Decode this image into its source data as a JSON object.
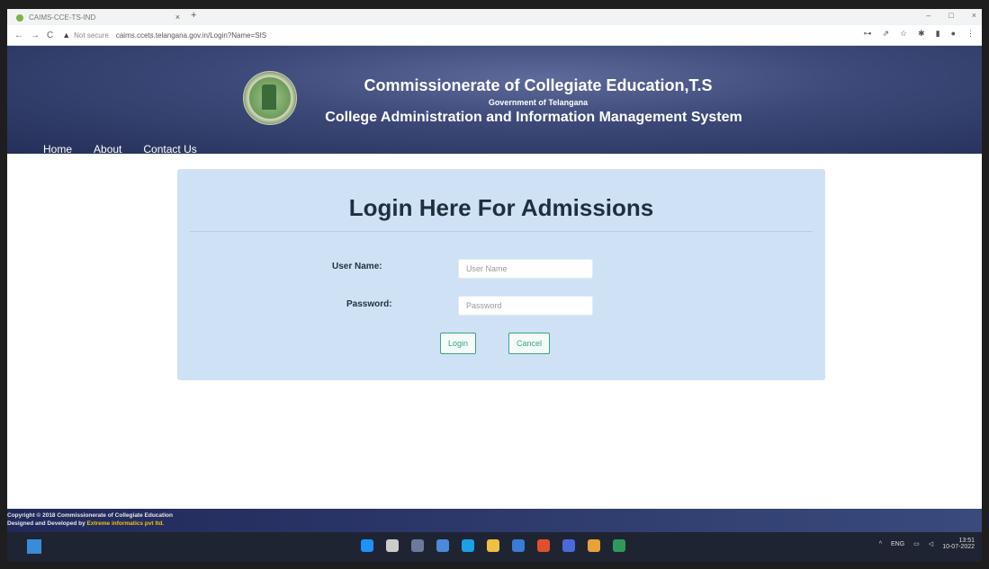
{
  "browser": {
    "tab_title": "CAIMS-CCE-TS-IND",
    "tab_close": "×",
    "new_tab": "+",
    "window_controls": [
      "–",
      "□",
      "×"
    ],
    "not_secure": "Not secure",
    "url": "caims.ccets.telangana.gov.in/Login?Name=SIS"
  },
  "header": {
    "title": "Commissionerate of Collegiate Education,T.S",
    "subtitle": "Government of Telangana",
    "system_name": "College Administration and Information Management System"
  },
  "menu": {
    "items": [
      {
        "label": "Home"
      },
      {
        "label": "About"
      },
      {
        "label": "Contact Us"
      }
    ]
  },
  "login": {
    "heading": "Login Here For Admissions",
    "username_label": "User Name:",
    "username_placeholder": "User Name",
    "password_label": "Password:",
    "password_placeholder": "Password",
    "login_button": "Login",
    "cancel_button": "Cancel"
  },
  "footer": {
    "copyright": "Copyright © 2018 Commissionerate of Collegiate Education",
    "designed_prefix": "Designed and Developed by",
    "developer": "Extreme informatics pvt ltd."
  },
  "taskbar": {
    "lang": "ENG",
    "time": "13:51",
    "date": "10-07-2022",
    "icon_colors": [
      "#1e90ff",
      "#cccccc",
      "#6a7a9a",
      "#4a8ad8",
      "#1aa1e8",
      "#f0c040",
      "#3a7bd5",
      "#e0502e",
      "#4a6ad8",
      "#e8a23a",
      "#2e9a5a"
    ]
  },
  "colors": {
    "header_bg": "#3d4a7a",
    "card_bg": "#cfe2f5",
    "button_accent": "#3aa388",
    "footer_highlight": "#f1c40f"
  }
}
